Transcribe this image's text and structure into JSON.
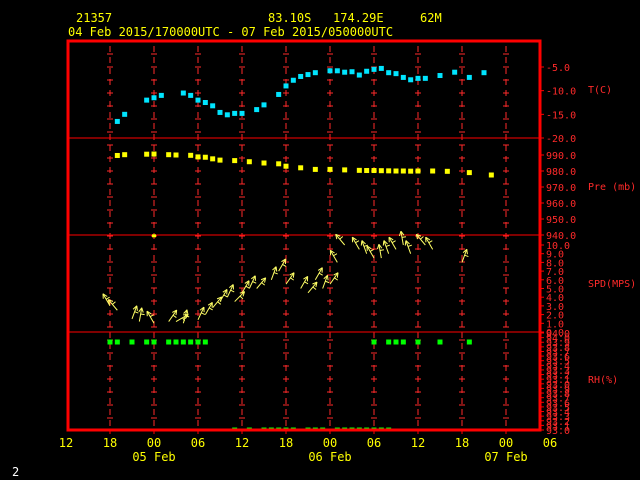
{
  "header": {
    "station_id": "21357",
    "latitude": "83.10S",
    "longitude": "174.29E",
    "elevation": "62M",
    "time_range": "04 Feb 2015/170000UTC - 07 Feb 2015/050000UTC"
  },
  "page_number": "2",
  "colors": {
    "background": "#000000",
    "frame": "#ff0000",
    "grid": "#ff2a2a",
    "text": "#ffff00",
    "temperature": "#00e5ff",
    "pressure": "#ffff00",
    "wind": "#ffff66",
    "humidity": "#00ff00"
  },
  "chart_data": [
    {
      "type": "scatter",
      "panel": "temperature",
      "ylabel": "T(C)",
      "yticks": [
        "-5.0",
        "-10.0",
        "-15.0",
        "-20.0"
      ],
      "ylim": [
        -20,
        -3
      ],
      "x_hours_since_start": [
        1,
        2,
        5,
        6,
        7,
        10,
        11,
        12,
        13,
        14,
        15,
        16,
        17,
        18,
        20,
        21,
        23,
        24,
        25,
        26,
        27,
        28,
        30,
        31,
        32,
        33,
        34,
        35,
        36,
        37,
        38,
        39,
        40,
        41,
        42,
        43,
        45,
        47,
        49,
        51
      ],
      "values": [
        -16.5,
        -15,
        -12,
        -11.5,
        -11,
        -10.5,
        -11,
        -12,
        -12.5,
        -13.2,
        -14.6,
        -15.1,
        -14.8,
        -14.8,
        -14,
        -13,
        -10.8,
        -9,
        -7.8,
        -7,
        -6.6,
        -6.2,
        -5.8,
        -5.8,
        -6.1,
        -6,
        -6.7,
        -5.9,
        -5.5,
        -5.3,
        -6.2,
        -6.4,
        -7.2,
        -7.7,
        -7.4,
        -7.4,
        -6.8,
        -6.1,
        -7.2,
        -6.2
      ]
    },
    {
      "type": "scatter",
      "panel": "pressure",
      "ylabel": "Pre (mb)",
      "yticks": [
        "990.0",
        "980.0",
        "970.0",
        "960.0",
        "950.0",
        "940.0"
      ],
      "ylim": [
        937,
        1000
      ],
      "x_hours_since_start": [
        1,
        2,
        5,
        6,
        8,
        9,
        11,
        12,
        13,
        14,
        15,
        17,
        19,
        21,
        23,
        24,
        26,
        28,
        30,
        32,
        34,
        35,
        36,
        37,
        38,
        39,
        40,
        41,
        42,
        44,
        46,
        49,
        52
      ],
      "values": [
        989.7,
        990.2,
        990.5,
        990.6,
        990.2,
        990,
        989.8,
        988.8,
        988.6,
        987.6,
        986.8,
        986.5,
        985.8,
        985,
        984.5,
        983,
        982,
        981,
        981,
        980.7,
        980.4,
        980.3,
        980.3,
        980.2,
        980.1,
        980,
        980,
        979.9,
        980,
        980,
        979.8,
        979,
        977.5
      ],
      "isolated_point": {
        "x": 6,
        "value": 939.5
      }
    },
    {
      "type": "barb",
      "panel": "wind",
      "ylabel": "SPD(MPS)",
      "yticks": [
        "10.0",
        "9.0",
        "8.0",
        "7.0",
        "6.0",
        "5.0",
        "4.0",
        "3.0",
        "2.0",
        "1.0",
        "0.0"
      ],
      "ylim": [
        0,
        11
      ],
      "x_hours_since_start": [
        0,
        1,
        3,
        4,
        6,
        8,
        9,
        10,
        12,
        13,
        14,
        15,
        16,
        17,
        18,
        19,
        20,
        22,
        23,
        24,
        26,
        27,
        28,
        29,
        30,
        31,
        32,
        34,
        35,
        36,
        37,
        38,
        39,
        40,
        41,
        43,
        44,
        48
      ],
      "values": [
        3.0,
        2.5,
        1.5,
        1.2,
        1.0,
        1.2,
        1.2,
        1.0,
        1.4,
        2.0,
        2.8,
        3.5,
        4.0,
        3.5,
        4.5,
        5.0,
        5.0,
        6.0,
        7.0,
        5.5,
        5.0,
        4.5,
        6.0,
        5.0,
        5.5,
        8.0,
        10.0,
        9.5,
        9.0,
        8.5,
        8.5,
        9.0,
        9.5,
        10.0,
        9.0,
        10.0,
        9.5,
        8.0
      ],
      "directions_deg": [
        330,
        320,
        20,
        10,
        330,
        35,
        60,
        15,
        25,
        30,
        40,
        30,
        25,
        45,
        30,
        25,
        40,
        20,
        30,
        35,
        30,
        40,
        30,
        20,
        35,
        330,
        320,
        330,
        340,
        330,
        350,
        340,
        330,
        350,
        340,
        320,
        330,
        20
      ]
    },
    {
      "type": "scatter",
      "panel": "humidity",
      "ylabel": "RH(%)",
      "yticks": [
        "94.0",
        "94.0",
        "93.9",
        "93.8",
        "93.7",
        "93.6",
        "93.5",
        "93.4",
        "93.3",
        "93.2",
        "93.1",
        "93.0",
        "93.9",
        "93.8",
        "93.7",
        "93.6",
        "93.5",
        "93.4",
        "93.3",
        "93.2",
        "93.1",
        "93.0"
      ],
      "x_hours_since_start": [
        0,
        1,
        3,
        5,
        6,
        8,
        9,
        10,
        11,
        12,
        13,
        36,
        38,
        39,
        40,
        42,
        45,
        49
      ],
      "values": [
        94,
        94,
        94,
        94,
        94,
        94,
        94,
        94,
        94,
        94,
        94,
        94,
        94,
        94,
        94,
        94,
        94,
        94
      ],
      "bottom_x": [
        17,
        19,
        21,
        22,
        23,
        24,
        25,
        27,
        28,
        29,
        31,
        32,
        33,
        34,
        35,
        36,
        37,
        38
      ],
      "bottom_values": [
        93,
        93,
        93,
        93,
        93,
        93,
        93,
        93,
        93,
        93,
        93,
        93,
        93,
        93,
        93,
        93,
        93,
        93
      ]
    }
  ],
  "x_axis": {
    "hour_labels": [
      "12",
      "18",
      "00",
      "06",
      "12",
      "18",
      "00",
      "06",
      "12",
      "18",
      "00",
      "06"
    ],
    "hour_positions": [
      -6,
      0,
      6,
      12,
      18,
      24,
      30,
      36,
      42,
      48,
      54,
      60
    ],
    "day_labels": [
      {
        "text": "05 Feb",
        "hour": 6
      },
      {
        "text": "06 Feb",
        "hour": 30
      },
      {
        "text": "07 Feb",
        "hour": 54
      }
    ]
  }
}
